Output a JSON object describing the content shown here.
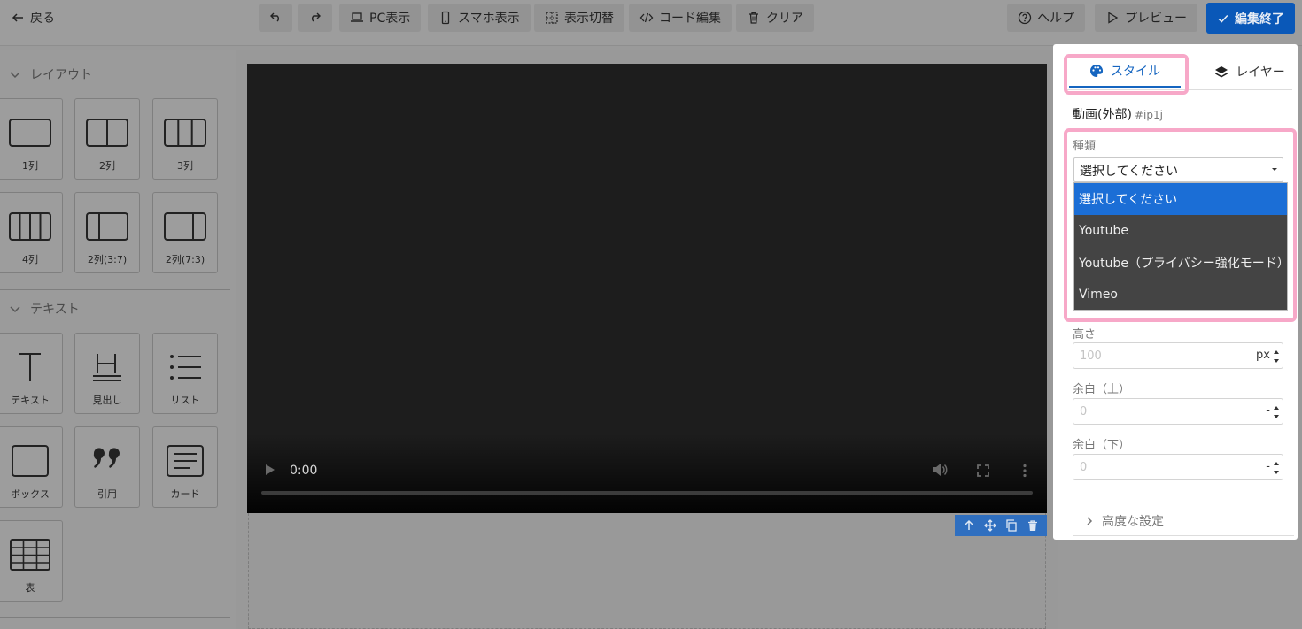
{
  "toolbar": {
    "back_label": "戻る",
    "pc_view_label": "PC表示",
    "sp_view_label": "スマホ表示",
    "toggle_view_label": "表示切替",
    "code_edit_label": "コード編集",
    "clear_label": "クリア",
    "help_label": "ヘルプ",
    "preview_label": "プレビュー",
    "finish_label": "編集終了",
    "finish_color": "#0a58b8"
  },
  "sidebar": {
    "layout_section": "レイアウト",
    "text_section": "テキスト",
    "layout_blocks": [
      "1列",
      "2列",
      "3列",
      "4列",
      "2列(3:7)",
      "2列(7:3)"
    ],
    "text_blocks": [
      "テキスト",
      "見出し",
      "リスト",
      "ボックス",
      "引用",
      "カード",
      "表"
    ]
  },
  "video": {
    "time": "0:00"
  },
  "panel": {
    "tab_style": "スタイル",
    "tab_layer": "レイヤー",
    "component_name": "動画(外部)",
    "component_id": "#ip1j",
    "type_label": "種類",
    "type_value": "選択してください",
    "type_options": [
      "選択してください",
      "Youtube",
      "Youtube（プライバシー強化モード）",
      "Vimeo"
    ],
    "height_label": "高さ",
    "height_placeholder": "100",
    "height_unit": "px",
    "margin_top_label": "余白（上）",
    "margin_top_placeholder": "0",
    "margin_top_unit": "-",
    "margin_bottom_label": "余白（下）",
    "margin_bottom_placeholder": "0",
    "margin_bottom_unit": "-",
    "advanced_label": "高度な設定",
    "accent_color": "#1565c0",
    "highlight_color": "#f7a8c8"
  }
}
